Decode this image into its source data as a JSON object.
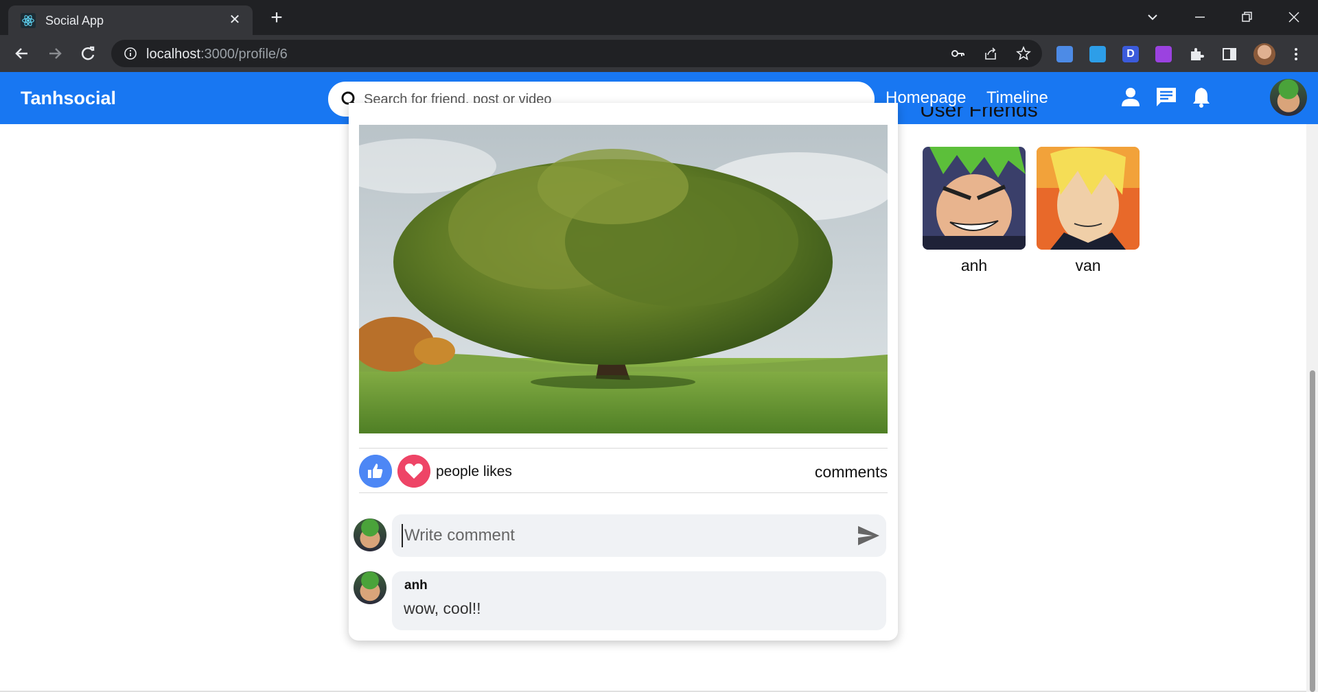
{
  "browser": {
    "tab_title": "Social App",
    "url_host": "localhost",
    "url_path": ":3000/profile/6"
  },
  "header": {
    "brand": "Tanhsocial",
    "search_placeholder": "Search for friend, post or video",
    "nav_links": [
      "Homepage",
      "Timeline"
    ]
  },
  "post": {
    "likes_label": "people likes",
    "comments_label": "comments",
    "comment_placeholder": "Write comment",
    "comments": [
      {
        "author": "anh",
        "text": "wow, cool!!"
      }
    ]
  },
  "friends": {
    "title": "User Friends",
    "items": [
      {
        "name": "anh"
      },
      {
        "name": "van"
      }
    ]
  },
  "colors": {
    "brand_blue": "#1877f2",
    "like_blue": "#4d87f5",
    "heart_red": "#ee4466"
  },
  "icons": [
    "search-icon",
    "person-icon",
    "chat-icon",
    "bell-icon",
    "send-icon",
    "thumbs-up-icon",
    "heart-icon"
  ]
}
